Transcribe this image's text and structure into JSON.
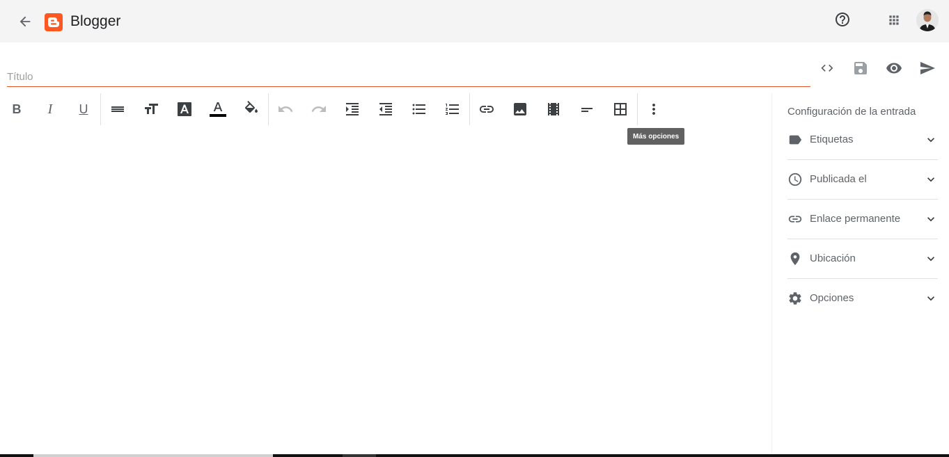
{
  "app": {
    "name": "Blogger"
  },
  "title": {
    "placeholder": "Título",
    "value": ""
  },
  "actions": [
    {
      "name": "html-view",
      "icon": "code-icon"
    },
    {
      "name": "save",
      "icon": "save-icon"
    },
    {
      "name": "preview",
      "icon": "eye-icon"
    },
    {
      "name": "publish",
      "icon": "send-icon"
    }
  ],
  "toolbar": {
    "bold": "B",
    "italic": "I",
    "underline": "U",
    "text_color_letter": "A",
    "tooltip": "Más opciones"
  },
  "sidebar": {
    "title": "Configuración de la entrada",
    "items": [
      {
        "label": "Etiquetas",
        "icon": "label-icon"
      },
      {
        "label": "Publicada el",
        "icon": "clock-icon"
      },
      {
        "label": "Enlace permanente",
        "icon": "link-icon"
      },
      {
        "label": "Ubicación",
        "icon": "location-pin-icon"
      },
      {
        "label": "Opciones",
        "icon": "gear-icon"
      }
    ]
  },
  "colors": {
    "accent": "#e7542a",
    "icon": "#5f6368",
    "text_color_bar": "#000000"
  }
}
